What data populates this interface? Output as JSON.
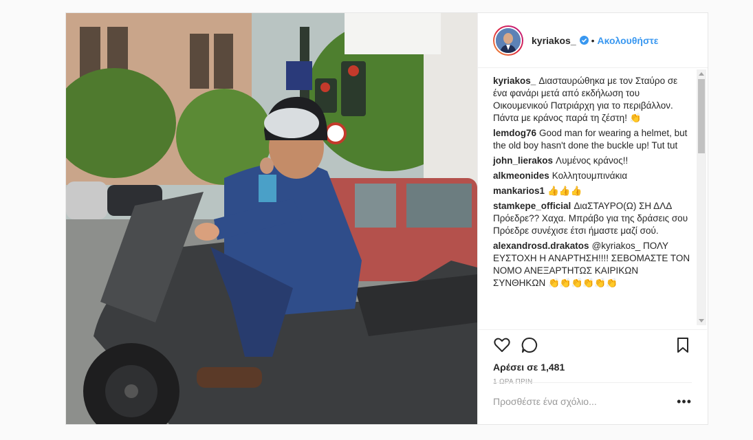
{
  "header": {
    "username": "kyriakos_",
    "dot": "•",
    "follow_label": "Ακολουθήστε"
  },
  "comments": [
    {
      "user": "kyriakos_",
      "text": "Διασταυρώθηκα με τον Σταύρο σε ένα φανάρι μετά από εκδήλωση του Οικουμενικού Πατριάρχη για το περιβάλλον. Πάντα με κράνος παρά τη ζέστη! 👏"
    },
    {
      "user": "lemdog76",
      "text": "Good man for wearing a helmet, but the old boy hasn't done the buckle up! Tut tut"
    },
    {
      "user": "john_lierakos",
      "text": "Λυμένος κράνος!!"
    },
    {
      "user": "alkmeonides",
      "text": "Κολλητουμπινάκια"
    },
    {
      "user": "mankarios1",
      "text": "👍👍👍"
    },
    {
      "user": "stamkepe_official",
      "text": "ΔιαΣΤΑΥΡΟ(Ω) ΣΗ ΔΛΔ Πρόεδρε?? Χαχα. Μπράβο για της δράσεις σου Πρόεδρε συνέχισε έτσι ήμαστε μαζί σού."
    },
    {
      "user": "alexandrosd.drakatos",
      "text": "@kyriakos_ ΠΟΛΥ ΕΥΣΤΟΧΗ Η ΑΝΑΡΤΗΣΗ!!!! ΣΕΒΟΜΑΣΤΕ ΤΟΝ ΝΟΜΟ ΑΝΕΞΑΡΤΗΤΩΣ ΚΑΙΡΙΚΩΝ ΣΥΝΘΗΚΩΝ 👏👏👏👏👏👏"
    }
  ],
  "likes": "Αρέσει σε 1,481",
  "time": "1 ΩΡΑ ΠΡΙΝ",
  "add_comment_placeholder": "Προσθέστε ένα σχόλιο...",
  "more_label": "•••",
  "icons": {
    "like": "heart-icon",
    "comment": "comment-icon",
    "save": "bookmark-icon",
    "verified": "verified-badge-icon"
  },
  "colors": {
    "link": "#3897f0",
    "text": "#262626",
    "muted": "#999999",
    "border": "#efefef"
  }
}
